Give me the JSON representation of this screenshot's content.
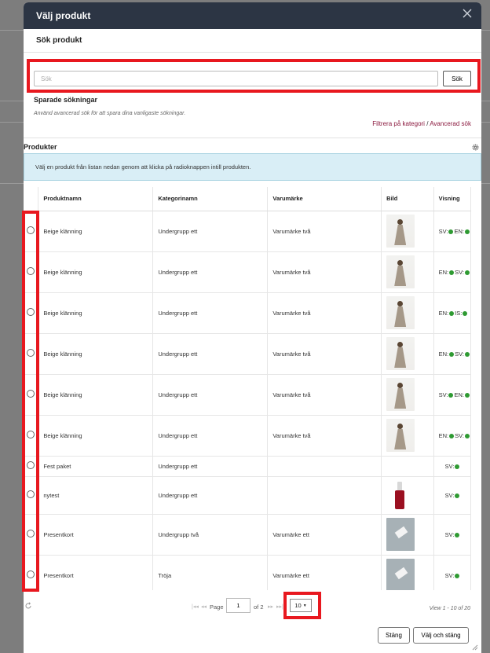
{
  "modal": {
    "title": "Välj produkt",
    "search_section_title": "Sök produkt",
    "search_placeholder": "Sök",
    "search_button": "Sök",
    "saved_title": "Sparade sökningar",
    "saved_hint": "Använd avancerad sök för att spara dina vanligaste sökningar.",
    "filter_category_link": "Filtrera på kategori",
    "filter_separator": "/",
    "advanced_search_link": "Avancerad sök",
    "products_title": "Produkter",
    "info_text": "Välj en produkt från listan nedan genom att klicka på radioknappen intill produkten."
  },
  "table": {
    "columns": [
      "Produktnamn",
      "Kategorinamn",
      "Varumärke",
      "Bild",
      "Visning"
    ],
    "rows": [
      {
        "name": "Beige klänning",
        "category": "Undergrupp ett",
        "brand": "Varumärke två",
        "image": "dress",
        "visibility": [
          "SV:",
          "EN:"
        ]
      },
      {
        "name": "Beige klänning",
        "category": "Undergrupp ett",
        "brand": "Varumärke två",
        "image": "dress",
        "visibility": [
          "EN:",
          "SV:"
        ]
      },
      {
        "name": "Beige klänning",
        "category": "Undergrupp ett",
        "brand": "Varumärke två",
        "image": "dress",
        "visibility": [
          "EN:",
          "IS:"
        ]
      },
      {
        "name": "Beige klänning",
        "category": "Undergrupp ett",
        "brand": "Varumärke två",
        "image": "dress",
        "visibility": [
          "EN:",
          "SV:"
        ]
      },
      {
        "name": "Beige klänning",
        "category": "Undergrupp ett",
        "brand": "Varumärke två",
        "image": "dress",
        "visibility": [
          "SV:",
          "EN:"
        ]
      },
      {
        "name": "Beige klänning",
        "category": "Undergrupp ett",
        "brand": "Varumärke två",
        "image": "dress",
        "visibility": [
          "EN:",
          "SV:"
        ]
      },
      {
        "name": "Fest paket",
        "category": "Undergrupp ett",
        "brand": "",
        "image": "",
        "visibility": [
          "SV:"
        ]
      },
      {
        "name": "nytest",
        "category": "Undergrupp ett",
        "brand": "",
        "image": "bottle",
        "visibility": [
          "SV:"
        ]
      },
      {
        "name": "Presentkort",
        "category": "Undergrupp två",
        "brand": "Varumärke ett",
        "image": "card",
        "visibility": [
          "SV:"
        ]
      },
      {
        "name": "Presentkort",
        "category": "Tröja",
        "brand": "Varumärke ett",
        "image": "card",
        "visibility": [
          "SV:"
        ]
      }
    ]
  },
  "pager": {
    "first": "|◂◂",
    "prev": "◂◂",
    "page_label": "Page",
    "current_page": "1",
    "of_label": "of 2",
    "next": "▸▸",
    "last": "▸▸|",
    "page_size": "10",
    "view_info": "View 1 - 10 of 20"
  },
  "footer": {
    "close_button": "Stäng",
    "select_close_button": "Välj och stäng"
  },
  "colors": {
    "header_bg": "#2c3544",
    "highlight": "#e8181f",
    "link": "#8b1a3f",
    "status_dot": "#2e9a32",
    "info_bg": "#d9eef6"
  },
  "icons": [
    "close-icon",
    "gear-icon",
    "refresh-icon",
    "chevron-down-icon"
  ]
}
